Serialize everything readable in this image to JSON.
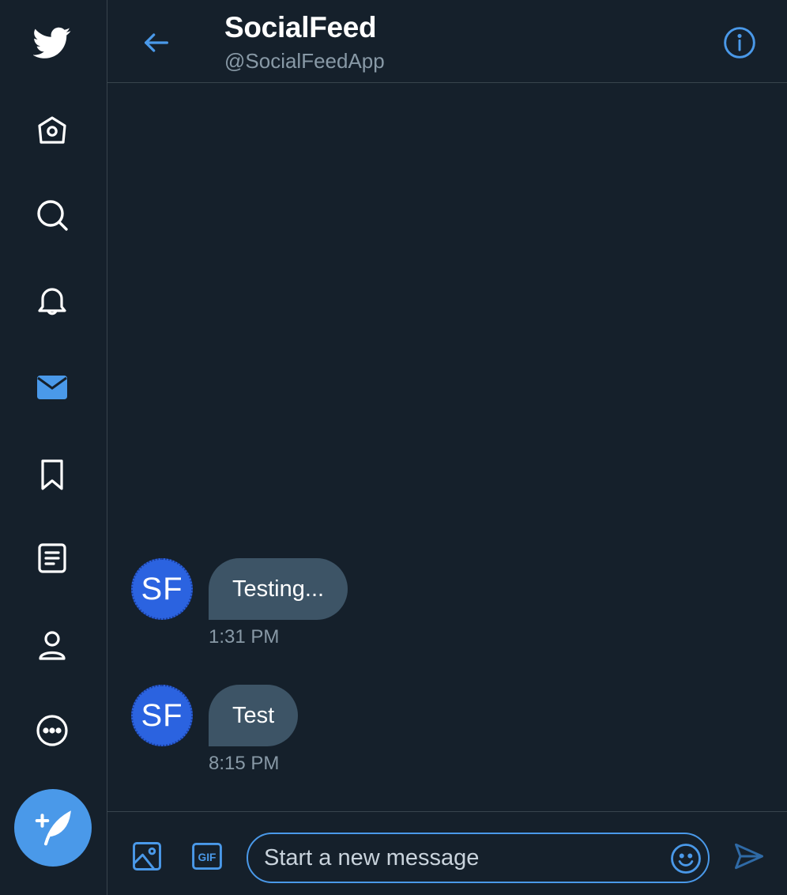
{
  "colors": {
    "background": "#15202b",
    "accent": "#4a99e9",
    "divider": "#38444d",
    "bubble": "#3d5466",
    "secondary_text": "#8899a6",
    "avatar": "#2b63e0"
  },
  "sidebar": {
    "items": [
      {
        "icon": "bird-logo-icon",
        "active": false
      },
      {
        "icon": "home-icon",
        "active": false
      },
      {
        "icon": "search-icon",
        "active": false
      },
      {
        "icon": "bell-icon",
        "active": false
      },
      {
        "icon": "mail-icon",
        "active": true
      },
      {
        "icon": "bookmark-icon",
        "active": false
      },
      {
        "icon": "list-icon",
        "active": false
      },
      {
        "icon": "profile-icon",
        "active": false
      },
      {
        "icon": "more-icon",
        "active": false
      }
    ],
    "compose_icon": "compose-feather-icon"
  },
  "header": {
    "title": "SocialFeed",
    "handle": "@SocialFeedApp",
    "back_icon": "back-arrow-icon",
    "info_icon": "info-icon"
  },
  "messages": [
    {
      "avatar_initials": "SF",
      "text": "Testing...",
      "time": "1:31 PM"
    },
    {
      "avatar_initials": "SF",
      "text": "Test",
      "time": "8:15 PM"
    }
  ],
  "composer": {
    "placeholder": "Start a new message",
    "value": "",
    "media_icon": "image-icon",
    "gif_icon": "gif-icon",
    "gif_label": "GIF",
    "emoji_icon": "emoji-icon",
    "send_icon": "send-icon"
  }
}
